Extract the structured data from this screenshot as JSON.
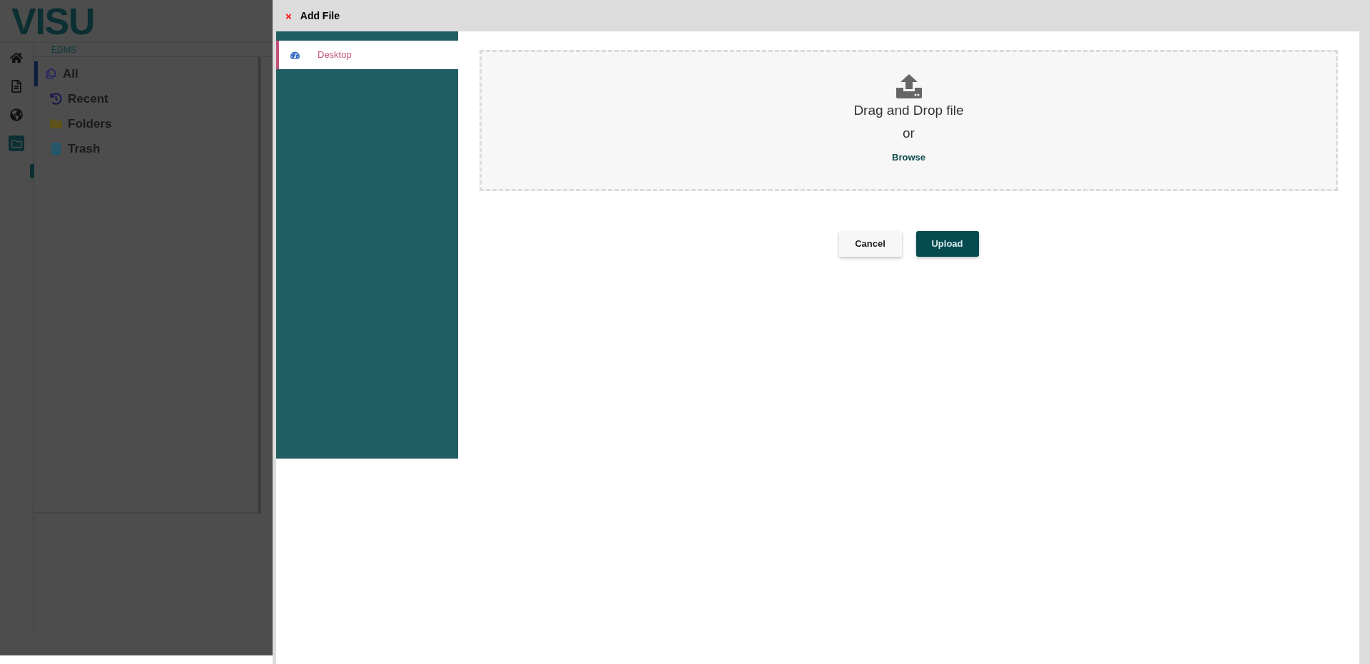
{
  "app": {
    "logo": "VISU",
    "section": "EDMS"
  },
  "rail": [
    {
      "selected": false
    },
    {
      "selected": false
    },
    {
      "selected": false
    },
    {
      "selected": true
    }
  ],
  "nav": [
    {
      "label": "All",
      "selected": true
    },
    {
      "label": "Recent",
      "selected": false
    },
    {
      "label": "Folders",
      "selected": false
    },
    {
      "label": "Trash",
      "selected": false
    }
  ],
  "dialog": {
    "close": "×",
    "title": "Add File",
    "sources": [
      {
        "label": "Desktop",
        "selected": true
      }
    ],
    "dropzone": {
      "title": "Drag and Drop file",
      "or": "or",
      "browse": "Browse"
    },
    "buttons": [
      {
        "label": "Cancel",
        "kind": "secondary"
      },
      {
        "label": "Upload",
        "kind": "primary"
      }
    ]
  }
}
